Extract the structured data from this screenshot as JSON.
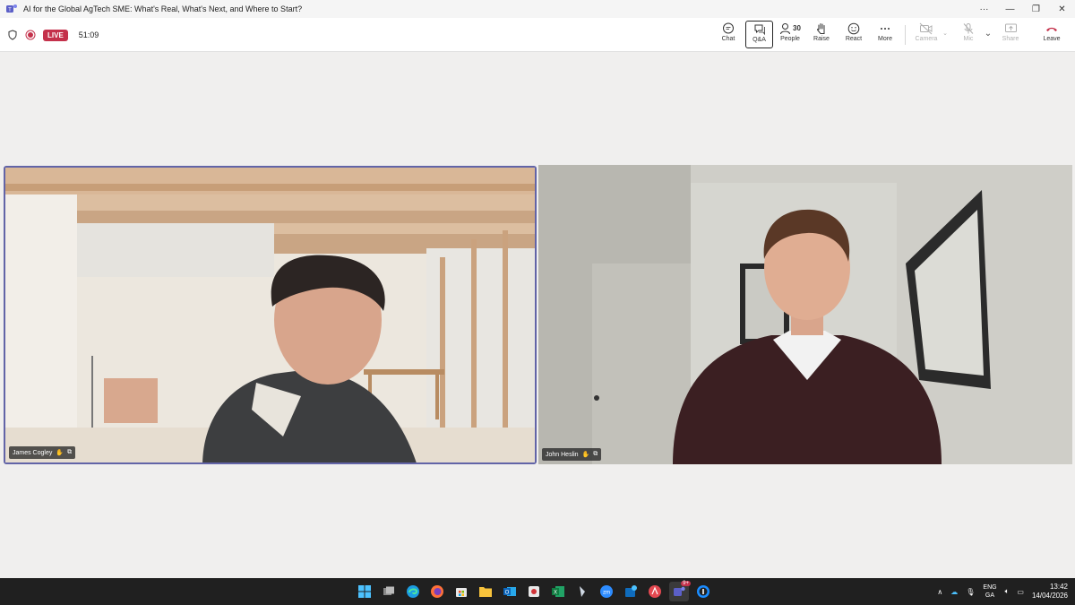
{
  "window": {
    "title": "AI for the Global AgTech SME: What's Real, What's Next, and Where to Start?",
    "controls": [
      "more-options",
      "minimize",
      "restore",
      "close"
    ]
  },
  "meeting": {
    "live_label": "LIVE",
    "timer": "51:09"
  },
  "toolbar": {
    "chat": "Chat",
    "qa": "Q&A",
    "people": "People",
    "people_count": "30",
    "raise": "Raise",
    "react": "React",
    "more": "More",
    "camera": "Camera",
    "mic": "Mic",
    "share": "Share",
    "leave": "Leave",
    "leave_color": "#c4314b",
    "active_button": "Q&A"
  },
  "participants": [
    {
      "name": "James Cogley",
      "speaking": true
    },
    {
      "name": "John Heslin",
      "speaking": false
    }
  ],
  "taskbar": {
    "apps": [
      "windows-start",
      "task-view",
      "edge",
      "firefox",
      "store",
      "file-explorer",
      "outlook",
      "snipping",
      "excel",
      "cursor",
      "zoom",
      "outlook-new",
      "acrobat",
      "teams",
      "1password"
    ],
    "teams_badge": "9+",
    "language": "ENG",
    "keyboard": "GA",
    "time": "13:42",
    "date": "14/04/2026"
  }
}
